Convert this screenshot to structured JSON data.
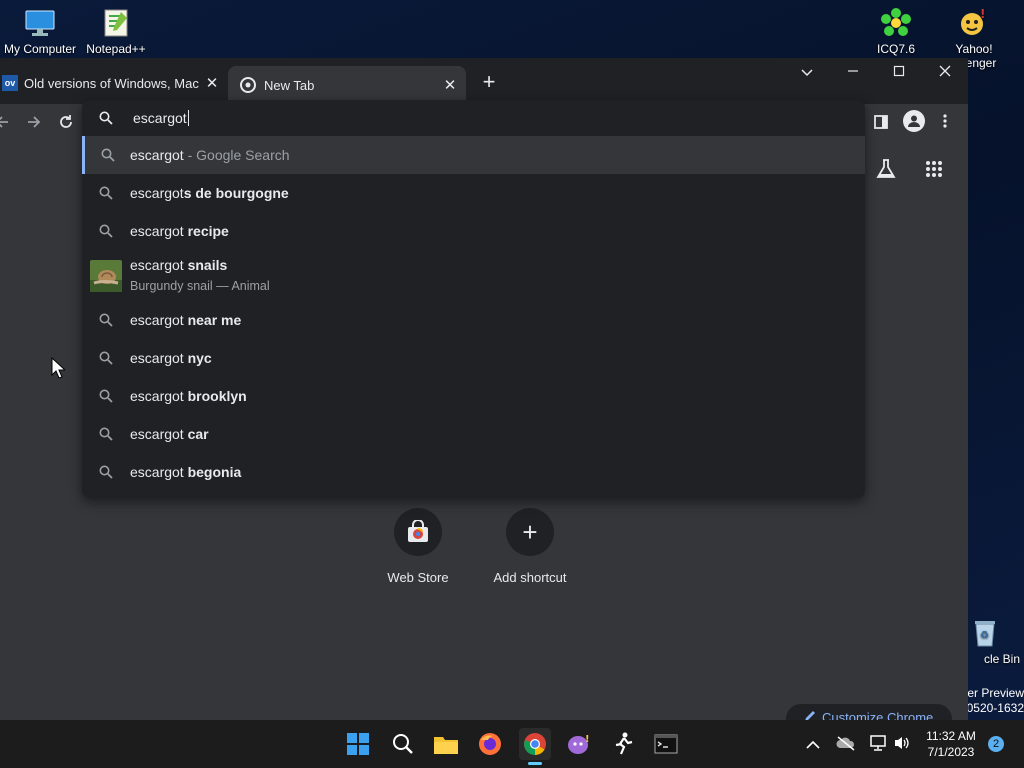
{
  "desktop": {
    "icons": [
      {
        "label": "My Computer",
        "icon": "monitor-icon"
      },
      {
        "label": "Notepad++",
        "icon": "notepad-icon"
      },
      {
        "label": "ICQ7.6",
        "icon": "icq-flower-icon"
      },
      {
        "label": "Yahoo!",
        "label2": "senger",
        "icon": "yahoo-messenger-icon"
      },
      {
        "label": "cle Bin",
        "icon": "recycle-bin-icon"
      }
    ],
    "watermark": {
      "line1": "er Preview",
      "line2": "0520-1632"
    }
  },
  "browser": {
    "tabs": [
      {
        "favicon": "ov",
        "title": "Old versions of Windows, Mac ar",
        "close": "✕"
      },
      {
        "favicon": "chrome-icon",
        "title": "New Tab",
        "close": "✕"
      }
    ],
    "new_tab": "+",
    "window_controls": {
      "dropdown": "⌄",
      "minimize": "—",
      "maximize": "☐",
      "close": "✕"
    },
    "omnibox": {
      "value": "escargot",
      "suggestions": [
        {
          "plain": "escargot",
          "bold": "",
          "suffix": " - Google Search",
          "selected": true,
          "icon": "search-icon"
        },
        {
          "plain": "escargot",
          "bold": "s de bourgogne",
          "suffix": "",
          "selected": false,
          "icon": "search-icon"
        },
        {
          "plain": "escargot",
          "bold": " recipe",
          "suffix": "",
          "selected": false,
          "icon": "search-icon"
        },
        {
          "plain": "escargot",
          "bold": " snails",
          "sub": "Burgundy snail — Animal",
          "selected": false,
          "icon": "snail-thumbnail"
        },
        {
          "plain": "escargot",
          "bold": " near me",
          "suffix": "",
          "selected": false,
          "icon": "search-icon"
        },
        {
          "plain": "escargot",
          "bold": " nyc",
          "suffix": "",
          "selected": false,
          "icon": "search-icon"
        },
        {
          "plain": "escargot",
          "bold": " brooklyn",
          "suffix": "",
          "selected": false,
          "icon": "search-icon"
        },
        {
          "plain": "escargot",
          "bold": " car",
          "suffix": "",
          "selected": false,
          "icon": "search-icon"
        },
        {
          "plain": "escargot",
          "bold": " begonia",
          "suffix": "",
          "selected": false,
          "icon": "search-icon"
        }
      ]
    },
    "ntp": {
      "shortcuts": [
        {
          "label": "Web Store",
          "icon": "webstore-icon"
        },
        {
          "label": "Add shortcut",
          "icon": "plus-icon",
          "glyph": "+"
        }
      ],
      "customize": "Customize Chrome"
    }
  },
  "taskbar": {
    "clock": {
      "time": "11:32 AM",
      "date": "7/1/2023"
    },
    "notifications": "2"
  }
}
